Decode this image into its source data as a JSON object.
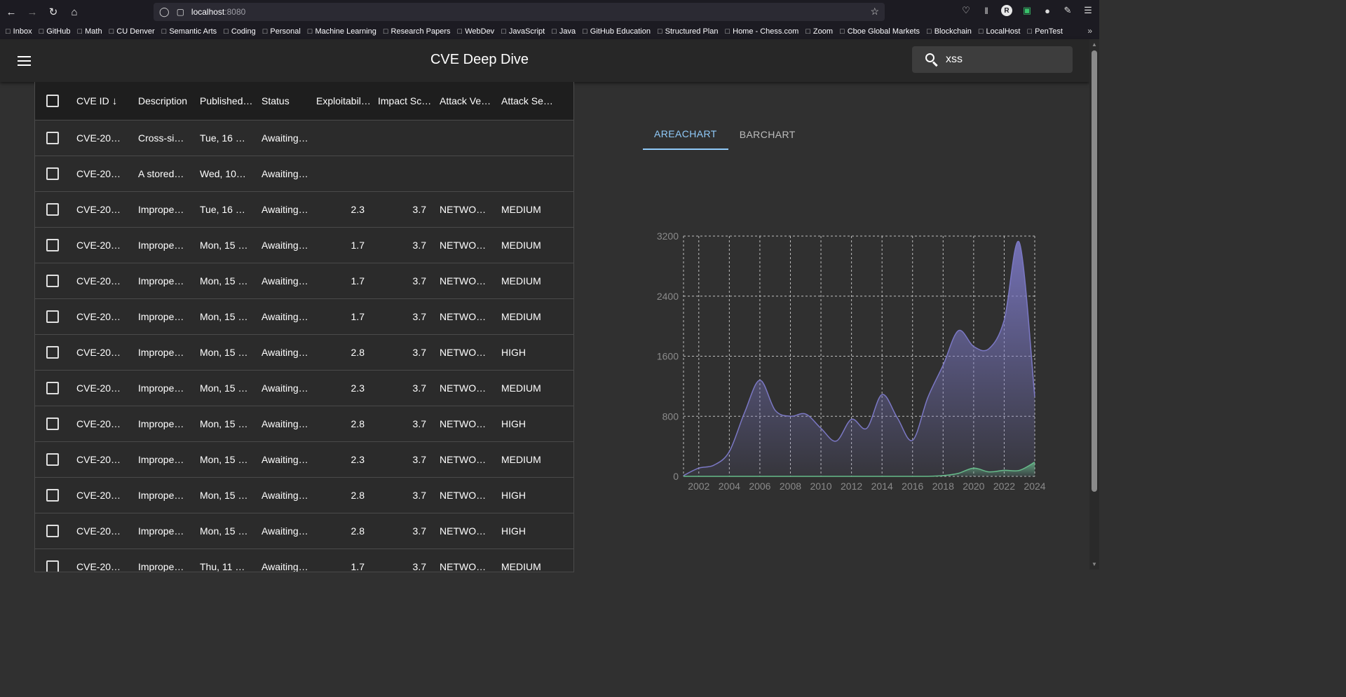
{
  "browser": {
    "url_host": "localhost",
    "url_port": ":8080",
    "bookmarks": [
      "Inbox",
      "GitHub",
      "Math",
      "CU Denver",
      "Semantic Arts",
      "Coding",
      "Personal",
      "Machine Learning",
      "Research Papers",
      "WebDev",
      "JavaScript",
      "Java",
      "GitHub Education",
      "Structured Plan",
      "Home - Chess.com",
      "Zoom",
      "Cboe Global Markets",
      "Blockchain",
      "LocalHost",
      "PenTest"
    ],
    "avatar_letter": "R"
  },
  "header": {
    "title": "CVE Deep Dive",
    "search_value": "xss"
  },
  "table": {
    "columns": [
      "CVE ID",
      "Description",
      "Published…",
      "Status",
      "Exploitabil…",
      "Impact Sc…",
      "Attack Ve…",
      "Attack Se…"
    ],
    "rows": [
      {
        "id": "CVE-20…",
        "desc": "Cross-si…",
        "pub": "Tue, 16 …",
        "status": "Awaiting…",
        "exp": "",
        "imp": "",
        "av": "",
        "as": ""
      },
      {
        "id": "CVE-20…",
        "desc": "A stored…",
        "pub": "Wed, 10…",
        "status": "Awaiting…",
        "exp": "",
        "imp": "",
        "av": "",
        "as": ""
      },
      {
        "id": "CVE-20…",
        "desc": "Imprope…",
        "pub": "Tue, 16 …",
        "status": "Awaiting…",
        "exp": "2.3",
        "imp": "3.7",
        "av": "NETWO…",
        "as": "MEDIUM"
      },
      {
        "id": "CVE-20…",
        "desc": "Imprope…",
        "pub": "Mon, 15 …",
        "status": "Awaiting…",
        "exp": "1.7",
        "imp": "3.7",
        "av": "NETWO…",
        "as": "MEDIUM"
      },
      {
        "id": "CVE-20…",
        "desc": "Imprope…",
        "pub": "Mon, 15 …",
        "status": "Awaiting…",
        "exp": "1.7",
        "imp": "3.7",
        "av": "NETWO…",
        "as": "MEDIUM"
      },
      {
        "id": "CVE-20…",
        "desc": "Imprope…",
        "pub": "Mon, 15 …",
        "status": "Awaiting…",
        "exp": "1.7",
        "imp": "3.7",
        "av": "NETWO…",
        "as": "MEDIUM"
      },
      {
        "id": "CVE-20…",
        "desc": "Imprope…",
        "pub": "Mon, 15 …",
        "status": "Awaiting…",
        "exp": "2.8",
        "imp": "3.7",
        "av": "NETWO…",
        "as": "HIGH"
      },
      {
        "id": "CVE-20…",
        "desc": "Imprope…",
        "pub": "Mon, 15 …",
        "status": "Awaiting…",
        "exp": "2.3",
        "imp": "3.7",
        "av": "NETWO…",
        "as": "MEDIUM"
      },
      {
        "id": "CVE-20…",
        "desc": "Imprope…",
        "pub": "Mon, 15 …",
        "status": "Awaiting…",
        "exp": "2.8",
        "imp": "3.7",
        "av": "NETWO…",
        "as": "HIGH"
      },
      {
        "id": "CVE-20…",
        "desc": "Imprope…",
        "pub": "Mon, 15 …",
        "status": "Awaiting…",
        "exp": "2.3",
        "imp": "3.7",
        "av": "NETWO…",
        "as": "MEDIUM"
      },
      {
        "id": "CVE-20…",
        "desc": "Imprope…",
        "pub": "Mon, 15 …",
        "status": "Awaiting…",
        "exp": "2.8",
        "imp": "3.7",
        "av": "NETWO…",
        "as": "HIGH"
      },
      {
        "id": "CVE-20…",
        "desc": "Imprope…",
        "pub": "Mon, 15 …",
        "status": "Awaiting…",
        "exp": "2.8",
        "imp": "3.7",
        "av": "NETWO…",
        "as": "HIGH"
      },
      {
        "id": "CVE-20…",
        "desc": "Imprope…",
        "pub": "Thu, 11 …",
        "status": "Awaiting…",
        "exp": "1.7",
        "imp": "3.7",
        "av": "NETWO…",
        "as": "MEDIUM"
      }
    ]
  },
  "tabs": [
    "AREACHART",
    "BARCHART"
  ],
  "active_tab": 0,
  "colors": {
    "accent": "#90caf9",
    "series1": "#7b78c4",
    "series2": "#66bb8a"
  },
  "chart_data": {
    "type": "area",
    "xticks": [
      "2002",
      "2004",
      "2006",
      "2008",
      "2010",
      "2012",
      "2014",
      "2016",
      "2018",
      "2020",
      "2022",
      "2024"
    ],
    "yticks": [
      "0",
      "800",
      "1600",
      "2400",
      "3200"
    ],
    "xlim": [
      2001,
      2024
    ],
    "ylim": [
      0,
      3200
    ],
    "grid": true,
    "series": [
      {
        "x": [
          2001,
          2002,
          2003,
          2004,
          2005,
          2006,
          2007,
          2008,
          2009,
          2010,
          2011,
          2012,
          2013,
          2014,
          2015,
          2016,
          2017,
          2018,
          2019,
          2020,
          2021,
          2022,
          2023,
          2024
        ],
        "values": [
          10,
          110,
          150,
          330,
          850,
          1280,
          880,
          800,
          830,
          640,
          470,
          760,
          640,
          1090,
          780,
          480,
          1050,
          1480,
          1940,
          1730,
          1700,
          2080,
          3110,
          1060
        ]
      },
      {
        "x": [
          2001,
          2002,
          2003,
          2004,
          2005,
          2006,
          2007,
          2008,
          2009,
          2010,
          2011,
          2012,
          2013,
          2014,
          2015,
          2016,
          2017,
          2018,
          2019,
          2020,
          2021,
          2022,
          2023,
          2024
        ],
        "values": [
          0,
          0,
          0,
          0,
          0,
          0,
          0,
          0,
          0,
          0,
          0,
          0,
          0,
          0,
          0,
          0,
          0,
          10,
          40,
          110,
          60,
          80,
          80,
          190
        ]
      }
    ]
  }
}
